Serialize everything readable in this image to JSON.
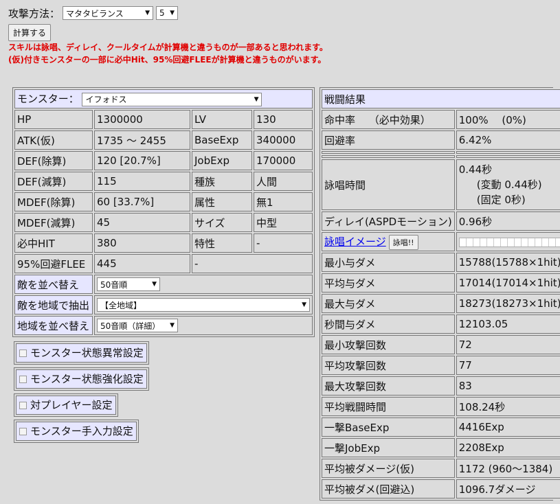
{
  "top": {
    "attack_label": "攻撃方法：",
    "attack_value": "マタタビランス",
    "level_value": "5",
    "calc_button": "計算する",
    "warning1": "スキルは詠唱、ディレイ、クールタイムが計算機と違うものが一部あると思われます。",
    "warning2": "(仮)付きモンスターの一部に必中Hit、95%回避FLEEが計算機と違うものがいます。"
  },
  "monster": {
    "label": "モンスター：",
    "selected": "イフォドス",
    "rows": [
      {
        "k1": "HP",
        "v1": "1300000",
        "k2": "LV",
        "v2": "130"
      },
      {
        "k1": "ATK(仮)",
        "v1": "1735 ～ 2455",
        "k2": "BaseExp",
        "v2": "340000"
      },
      {
        "k1": "DEF(除算)",
        "v1": "120 [20.7%]",
        "k2": "JobExp",
        "v2": "170000"
      },
      {
        "k1": "DEF(減算)",
        "v1": "115",
        "k2": "種族",
        "v2": "人間"
      },
      {
        "k1": "MDEF(除算)",
        "v1": "60 [33.7%]",
        "k2": "属性",
        "v2": "無1"
      },
      {
        "k1": "MDEF(減算)",
        "v1": "45",
        "k2": "サイズ",
        "v2": "中型"
      },
      {
        "k1": "必中HIT",
        "v1": "380",
        "k2": "特性",
        "v2": "-"
      }
    ],
    "flee_label": "95%回避FLEE",
    "flee_value": "445",
    "flee_extra": "-",
    "sort_label": "敵を並べ替え",
    "sort_value": "50音順",
    "area_label": "敵を地域で抽出",
    "area_value": "【全地域】",
    "area_sort_label": "地域を並べ替え",
    "area_sort_value": "50音順（詳細）"
  },
  "settings": {
    "status_abnormal": "モンスター状態異常設定",
    "status_buff": "モンスター状態強化設定",
    "pvp": "対プレイヤー設定",
    "manual": "モンスター手入力設定"
  },
  "result": {
    "title": "戦闘結果",
    "hit_label": "命中率　 （必中効果）",
    "hit_value": "100%　 (0%)",
    "flee_label": "回避率",
    "flee_value": "6.42%",
    "cast_label": "詠唱時間",
    "cast_value": "0.44秒",
    "cast_var": "(変動 0.44秒)",
    "cast_fixed": "(固定 0秒)",
    "delay_label": "ディレイ(ASPDモーション)",
    "delay_value": "0.96秒",
    "cast_image_link": "詠唱イメージ",
    "cast_button": "詠唱!!",
    "rows": [
      {
        "k": "最小与ダメ",
        "v": "15788(15788×1hit)"
      },
      {
        "k": "平均与ダメ",
        "v": "17014(17014×1hit)"
      },
      {
        "k": "最大与ダメ",
        "v": "18273(18273×1hit)"
      },
      {
        "k": "秒間与ダメ",
        "v": "12103.05"
      },
      {
        "k": "最小攻撃回数",
        "v": "72"
      },
      {
        "k": "平均攻撃回数",
        "v": "77"
      },
      {
        "k": "最大攻撃回数",
        "v": "83"
      },
      {
        "k": "平均戦闘時間",
        "v": "108.24秒"
      },
      {
        "k": "一撃BaseExp",
        "v": "4416Exp"
      },
      {
        "k": "一撃JobExp",
        "v": "2208Exp"
      },
      {
        "k": "平均被ダメージ(仮)",
        "v": "1172 (960～1384)"
      },
      {
        "k": "平均被ダメ(回避込)",
        "v": "1096.7ダメージ"
      }
    ]
  }
}
